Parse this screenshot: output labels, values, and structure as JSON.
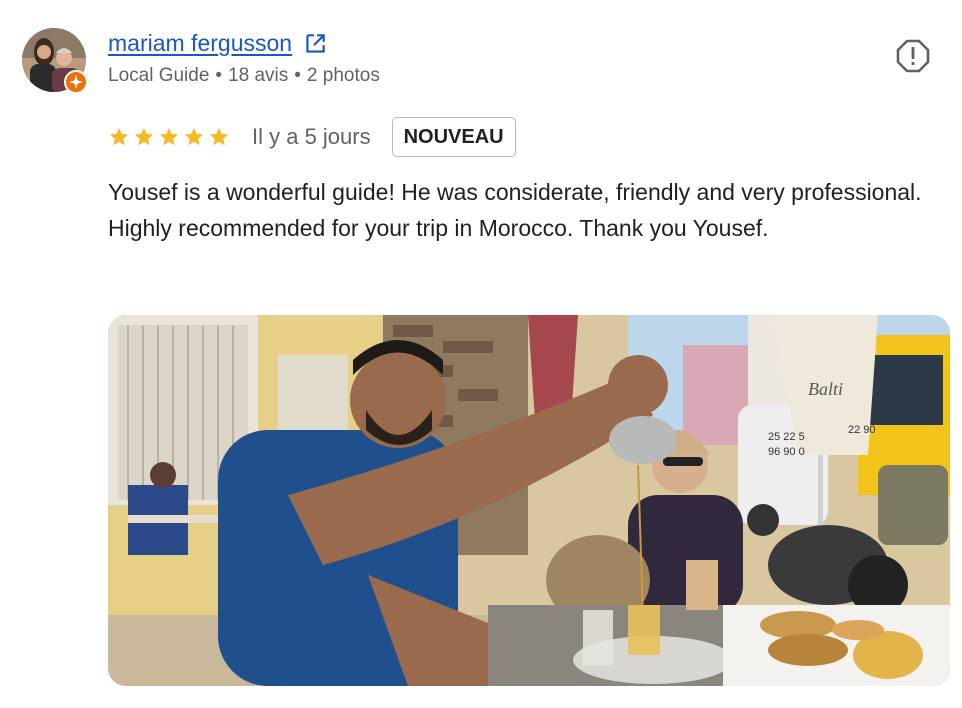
{
  "reviewer": {
    "name": "mariam fergusson",
    "meta": [
      "Local Guide",
      "18 avis",
      "2 photos"
    ],
    "separator": "•"
  },
  "rating": {
    "stars": 5,
    "max": 5,
    "star_color": "#f6b928"
  },
  "date": "Il y a 5 jours",
  "badge": "NOUVEAU",
  "review_text": "Yousef is a wonderful guide! He was considerate, friendly and very professional. Highly recommended for your trip in Morocco. Thank you Yousef.",
  "photo": {
    "sign_text": "Balti",
    "bus_numbers_left": "25 22 5",
    "bus_numbers_right": "96 90 0",
    "bus_numbers_far": "22 90"
  },
  "icons": {
    "external": "external-link-icon",
    "report": "report-flag-icon",
    "badge": "local-guide-badge-icon"
  },
  "colors": {
    "link": "#1a56c4",
    "meta": "#5f6368",
    "badge_orange": "#e8710a"
  }
}
